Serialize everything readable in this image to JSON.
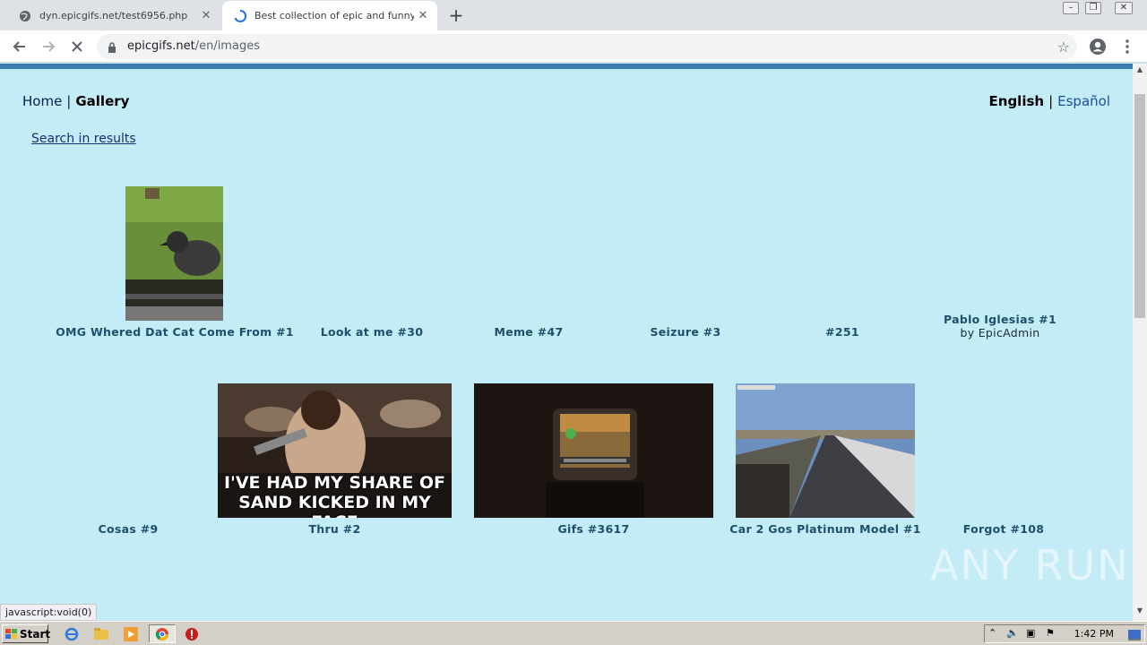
{
  "browser": {
    "tabs": [
      {
        "title": "dyn.epicgifs.net/test6956.php",
        "active": false
      },
      {
        "title": "Best collection of epic and funny gifs",
        "active": true
      }
    ],
    "url_host": "epicgifs.net",
    "url_path": "/en/images",
    "status_text": "javascript:void(0)"
  },
  "nav": {
    "home": "Home",
    "gallery": "Gallery",
    "separator": "|",
    "lang_english": "English",
    "lang_spanish": "Español"
  },
  "search_link": "Search in results",
  "gallery": {
    "row1": [
      {
        "caption": "OMG Whered Dat Cat Come From #1"
      },
      {
        "caption": "Look at me #30"
      },
      {
        "caption": "Meme #47"
      },
      {
        "caption": "Seizure #3"
      },
      {
        "caption": "#251"
      },
      {
        "caption": "Pablo Iglesias #1",
        "by": "by EpicAdmin"
      }
    ],
    "row2": [
      {
        "caption": "Cosas #9"
      },
      {
        "caption": "Thru #2",
        "overlay_text_1": "I'VE HAD MY SHARE OF",
        "overlay_text_2": "SAND KICKED IN MY FACE"
      },
      {
        "caption": "Gifs #3617"
      },
      {
        "caption": "Car 2 Gos Platinum Model #1"
      },
      {
        "caption": "Forgot #108"
      }
    ]
  },
  "watermark": "ANY RUN",
  "taskbar": {
    "start_label": "Start",
    "clock": "1:42 PM"
  },
  "colors": {
    "page_bg": "#c3ecf7",
    "header_bar": "#3e7cb0",
    "caption": "#1e4f6b"
  }
}
